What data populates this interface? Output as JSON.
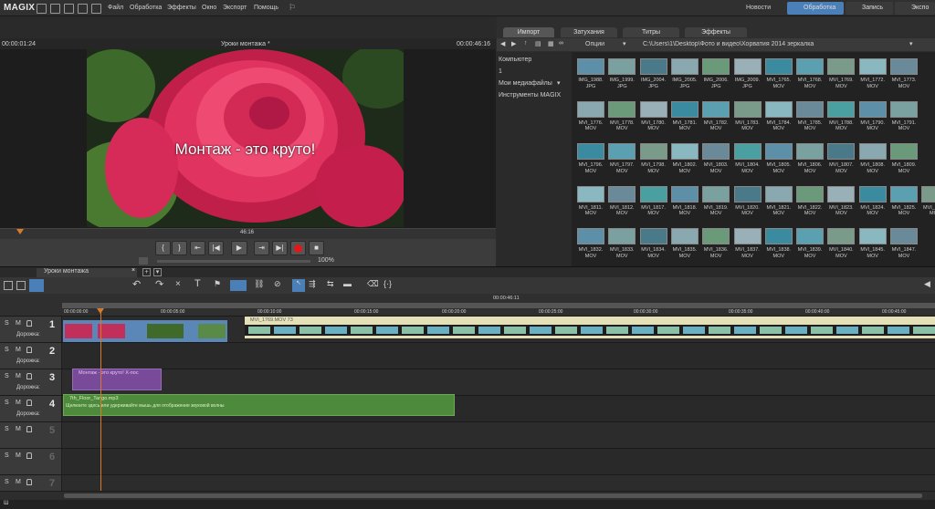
{
  "app": {
    "logo": "MAGIX"
  },
  "menu": [
    "Файл",
    "Обработка",
    "Эффекты",
    "Окно",
    "Экспорт",
    "Помощь"
  ],
  "modes": {
    "news": "Новости",
    "edit": "Обработка",
    "record": "Запись",
    "export": "Экспо"
  },
  "preview": {
    "time_current": "00:00:01:24",
    "project_title": "Уроки монтажа *",
    "time_total": "00:00:46:16",
    "overlay_text": "Монтаж - это круто!",
    "scrub_time": "46:16",
    "zoom": "100%"
  },
  "media": {
    "tabs": [
      "Импорт",
      "Затухания",
      "Титры",
      "Эффекты"
    ],
    "options_label": "Опции",
    "path": "C:\\Users\\1\\Desktop\\Фото и видео\\Хорватия 2014 зеркалка",
    "nav": [
      "Компьютер",
      "1",
      "Мои медиафайлы",
      "Инструменты MAGIX"
    ],
    "thumbs": [
      [
        "IMG_1988.\nJPG",
        "IMG_1999.\nJPG",
        "IMG_2004.\nJPG",
        "IMG_2005.\nJPG",
        "IMG_2006.\nJPG",
        "IMG_2009.\nJPG",
        "MVI_1765.\nMOV",
        "MVI_1768.\nMOV",
        "MVI_1769.\nMOV",
        "MVI_1772.\nMOV",
        "MVI_1773.\nMOV"
      ],
      [
        "MVI_1776.\nMOV",
        "MVI_1778.\nMOV",
        "MVI_1780.\nMOV",
        "MVI_1781.\nMOV",
        "MVI_1782.\nMOV",
        "MVI_1783.\nMOV",
        "MVI_1784.\nMOV",
        "MVI_1785.\nMOV",
        "MVI_1788.\nMOV",
        "MVI_1790.\nMOV",
        "MVI_1791.\nMOV"
      ],
      [
        "MVI_1796.\nMOV",
        "MVI_1797.\nMOV",
        "MVI_1798.\nMOV",
        "MVI_1802.\nMOV",
        "MVI_1803.\nMOV",
        "MVI_1804.\nMOV",
        "MVI_1805.\nMOV",
        "MVI_1806.\nMOV",
        "MVI_1807.\nMOV",
        "MVI_1808.\nMOV",
        "MVI_1809.\nMOV"
      ],
      [
        "MVI_1811.\nMOV",
        "MVI_1812.\nMOV",
        "MVI_1817.\nMOV",
        "MVI_1818.\nMOV",
        "MVI_1819.\nMOV",
        "MVI_1820.\nMOV",
        "MVI_1821.\nMOV",
        "MVI_1822.\nMOV",
        "MVI_1823.\nMOV",
        "MVI_1824.\nMOV",
        "MVI_1825.\nMOV",
        "MVI_1826.\nMOV"
      ],
      [
        "MVI_1832.\nMOV",
        "MVI_1833.\nMOV",
        "MVI_1834.\nMOV",
        "MVI_1835.\nMOV",
        "MVI_1836.\nMOV",
        "MVI_1837.\nMOV",
        "MVI_1838.\nMOV",
        "MVI_1839.\nMOV",
        "MVI_1840.\nMOV",
        "MVI_1845.\nMOV",
        "MVI_1847.\nMOV"
      ]
    ]
  },
  "timeline": {
    "tab": "Уроки монтажа",
    "ruler_marks": [
      "00:00:00:00",
      "00:00:05:00",
      "00:00:10:00",
      "00:00:15:00",
      "00:00:20:00",
      "00:00:25:00",
      "00:00:30:00",
      "00:00:35:00",
      "00:00:40:00",
      "00:00:45:00"
    ],
    "ruler_top": "00:00:46:11",
    "track_label": "Дорожка:",
    "tracks": [
      "1",
      "2",
      "3",
      "4",
      "5",
      "6",
      "7"
    ],
    "smb": [
      "S",
      "M"
    ],
    "clips": {
      "video2": "MVI_1769.MOV 73",
      "title": "Монтаж - это круто!   X-пос",
      "audio_name": "7th_Floor_Tango.mp3",
      "audio_hint": "Щелкните здесь или удерживайте мышь для отображения звуковой волны"
    }
  },
  "status": "Ш"
}
